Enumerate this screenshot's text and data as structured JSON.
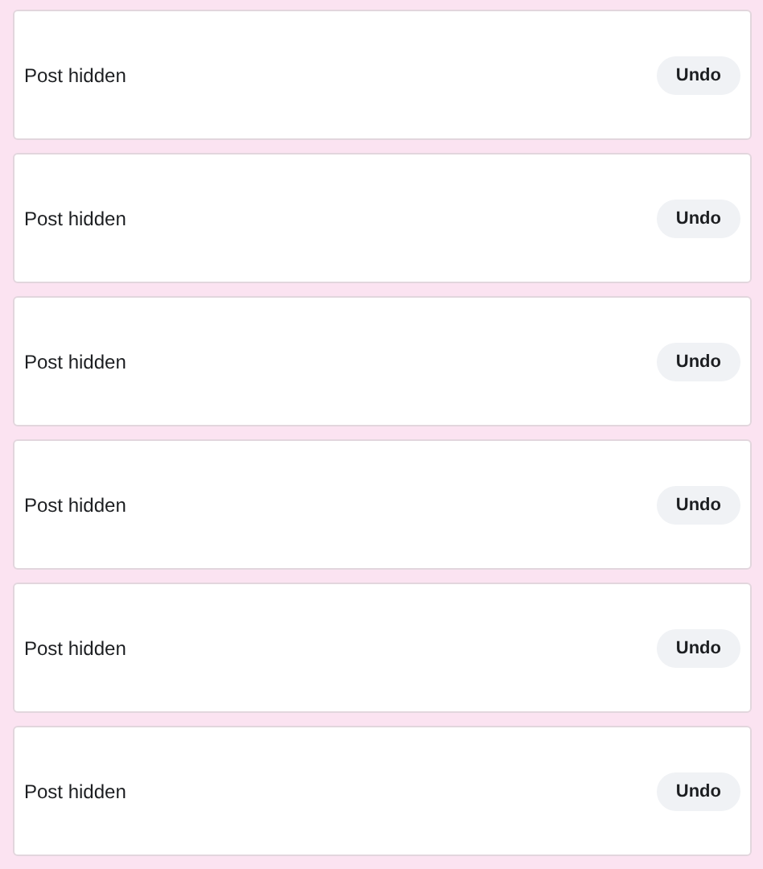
{
  "posts": [
    {
      "message": "Post hidden",
      "action": "Undo"
    },
    {
      "message": "Post hidden",
      "action": "Undo"
    },
    {
      "message": "Post hidden",
      "action": "Undo"
    },
    {
      "message": "Post hidden",
      "action": "Undo"
    },
    {
      "message": "Post hidden",
      "action": "Undo"
    },
    {
      "message": "Post hidden",
      "action": "Undo"
    }
  ]
}
